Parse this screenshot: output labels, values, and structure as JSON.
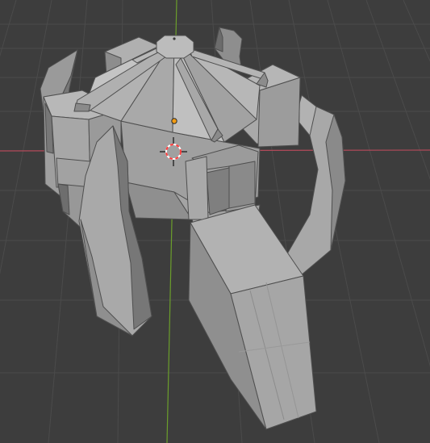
{
  "viewport": {
    "background": "#3d3d3d",
    "grid_color": "#4a4a4a",
    "x_axis_color": "#b34a5a",
    "y_axis_color": "#6b9e2b"
  },
  "scene": {
    "object": "tower-mesh",
    "mesh_face_color": "#a3a3a3",
    "mesh_dark_color": "#6a6a6a",
    "mesh_edge_color": "#4f4f4f"
  },
  "origin_marker": {
    "icon": "object-origin-dot",
    "color": "#f39c12"
  },
  "cursor": {
    "icon": "3d-cursor-icon",
    "ring_colors": [
      "#ff3b3b",
      "#ffffff"
    ]
  }
}
